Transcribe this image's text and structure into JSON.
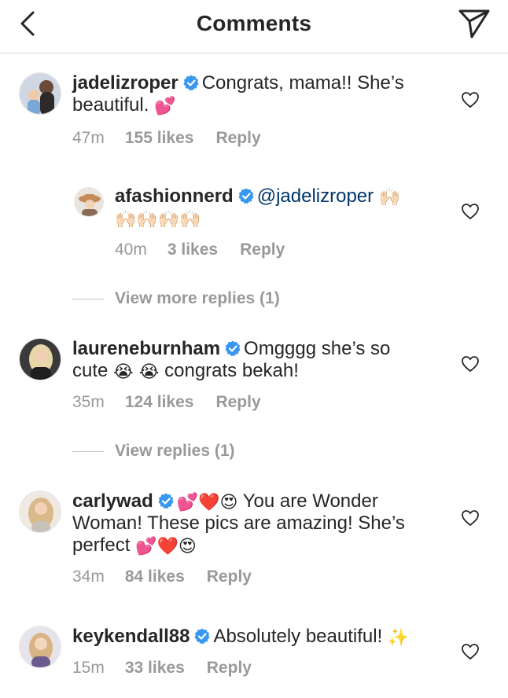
{
  "header": {
    "title": "Comments"
  },
  "comments": [
    {
      "username": "jadelizroper",
      "text": "Congrats, mama!! She’s beautiful.",
      "emoji": "💕",
      "time": "47m",
      "likes": "155 likes",
      "reply": "Reply"
    },
    {
      "username": "afashionnerd",
      "mention": "@jadelizroper",
      "emoji_inline": "🙌🏻",
      "emoji_line": "🙌🏻🙌🏻🙌🏻🙌🏻",
      "time": "40m",
      "likes": "3 likes",
      "reply": "Reply"
    },
    {
      "username": "laureneburnham",
      "text1": "Omgggg she’s so",
      "text2a": "cute",
      "emoji": "😭 😭",
      "text2b": "congrats bekah!",
      "time": "35m",
      "likes": "124 likes",
      "reply": "Reply"
    },
    {
      "username": "carlywad",
      "emoji1": "💕❤️😍",
      "text1": "You are Wonder",
      "text2": "Woman! These pics are amazing! She’s",
      "text3": "perfect",
      "emoji2": "💕❤️😍",
      "time": "34m",
      "likes": "84 likes",
      "reply": "Reply"
    },
    {
      "username": "keykendall88",
      "text": "Absolutely beautiful!",
      "emoji": "✨",
      "time": "15m",
      "likes": "33 likes",
      "reply": "Reply"
    }
  ],
  "view_more_replies": "View more replies (1)",
  "view_replies": "View replies (1)",
  "icons": {
    "back": "chevron-left-icon",
    "send": "paper-plane-icon",
    "heart": "heart-outline-icon",
    "verified": "verified-badge-icon"
  },
  "colors": {
    "verified": "#3897f0",
    "muted": "#999999",
    "text": "#262626"
  }
}
